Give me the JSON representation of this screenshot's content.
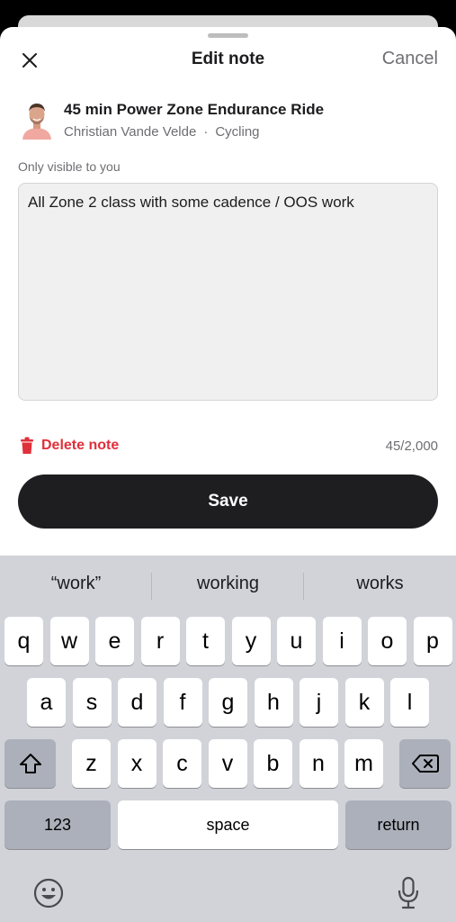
{
  "header": {
    "title": "Edit note",
    "cancel_label": "Cancel",
    "close_icon": "close-icon"
  },
  "class_info": {
    "title": "45 min Power Zone Endurance Ride",
    "instructor": "Christian Vande Velde",
    "separator": "·",
    "discipline": "Cycling"
  },
  "note": {
    "visibility_label": "Only visible to you",
    "text": "All Zone 2 class with some cadence / OOS work",
    "counter": "45/2,000"
  },
  "actions": {
    "delete_label": "Delete note",
    "save_label": "Save"
  },
  "colors": {
    "accent_red": "#e0303a",
    "save_button": "#1e1e20",
    "keyboard_bg": "#d1d3d9"
  },
  "keyboard": {
    "suggestions": [
      "“work”",
      "working",
      "works"
    ],
    "row1": [
      "q",
      "w",
      "e",
      "r",
      "t",
      "y",
      "u",
      "i",
      "o",
      "p"
    ],
    "row2": [
      "a",
      "s",
      "d",
      "f",
      "g",
      "h",
      "j",
      "k",
      "l"
    ],
    "row3": [
      "z",
      "x",
      "c",
      "v",
      "b",
      "n",
      "m"
    ],
    "numbers_label": "123",
    "space_label": "space",
    "return_label": "return",
    "shift_icon": "shift-icon",
    "backspace_icon": "backspace-icon",
    "emoji_icon": "emoji-icon",
    "mic_icon": "microphone-icon"
  }
}
